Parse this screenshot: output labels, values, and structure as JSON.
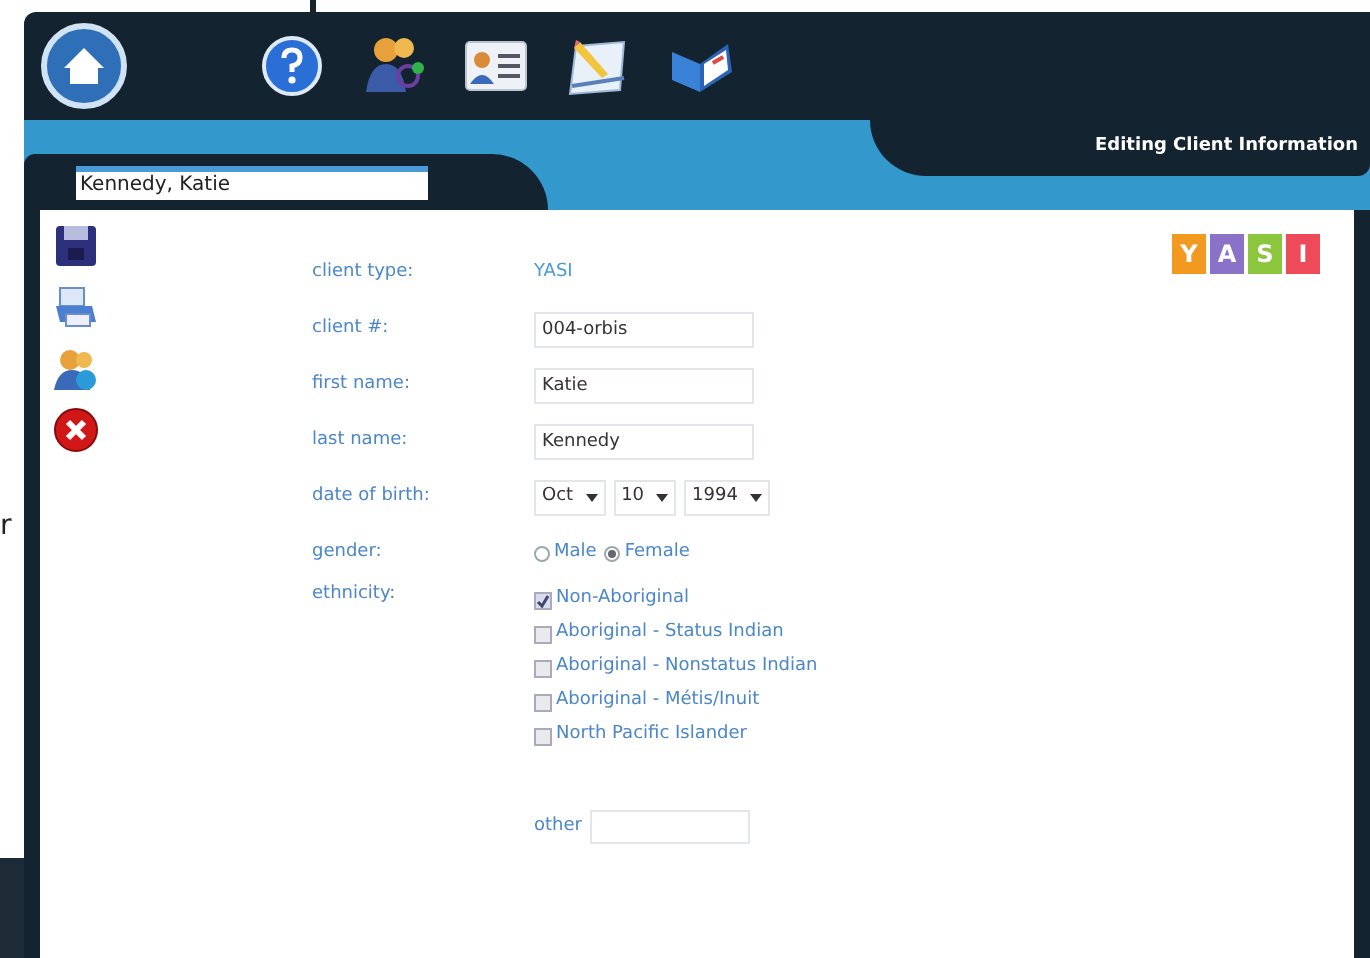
{
  "margin_text": "r",
  "header": {
    "title": "Editing Client Information"
  },
  "toolbar": [
    {
      "kind": "home"
    },
    {
      "kind": "help"
    },
    {
      "kind": "people"
    },
    {
      "kind": "card"
    },
    {
      "kind": "note"
    },
    {
      "kind": "book"
    }
  ],
  "client_name": {
    "value": "Kennedy, Katie"
  },
  "side_actions": [
    {
      "kind": "save"
    },
    {
      "kind": "print"
    },
    {
      "kind": "group"
    },
    {
      "kind": "delete"
    }
  ],
  "logo": [
    "Y",
    "A",
    "S",
    "I"
  ],
  "form": {
    "client_type": {
      "label": "client type:",
      "value": "YASI"
    },
    "client_number": {
      "label": "client #:",
      "value": "004-orbis"
    },
    "first_name": {
      "label": "first name:",
      "value": "Katie"
    },
    "last_name": {
      "label": "last name:",
      "value": "Kennedy"
    },
    "date_of_birth": {
      "label": "date of birth:",
      "month": "Oct",
      "day": "10",
      "year": "1994"
    },
    "gender": {
      "label": "gender:",
      "options": [
        {
          "label": "Male",
          "selected": false
        },
        {
          "label": "Female",
          "selected": true
        }
      ]
    },
    "ethnicity": {
      "label": "ethnicity:",
      "options": [
        {
          "label": "Non-Aboriginal",
          "checked": true
        },
        {
          "label": "Aboriginal - Status Indian",
          "checked": false
        },
        {
          "label": "Aboriginal - Nonstatus Indian",
          "checked": false
        },
        {
          "label": "Aboriginal - Métis/Inuit",
          "checked": false
        },
        {
          "label": "North Pacific Islander",
          "checked": false
        }
      ]
    },
    "other": {
      "label": "other"
    }
  }
}
